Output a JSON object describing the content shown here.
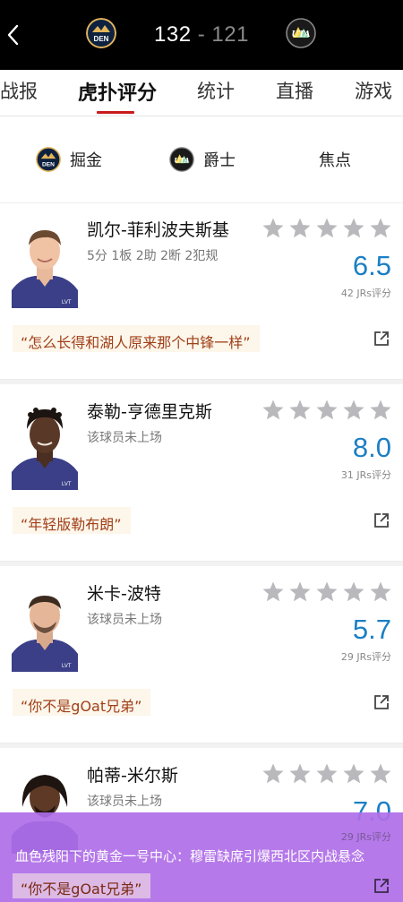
{
  "score": {
    "home": "132",
    "separator": "-",
    "away": "121",
    "home_team": "DEN",
    "away_team": "UTA"
  },
  "tabs": [
    {
      "label": "战报"
    },
    {
      "label": "虎扑评分"
    },
    {
      "label": "统计"
    },
    {
      "label": "直播"
    },
    {
      "label": "游戏"
    }
  ],
  "active_tab": "虎扑评分",
  "filters": [
    {
      "label": "掘金",
      "logo": "DEN"
    },
    {
      "label": "爵士",
      "logo": "UTA"
    },
    {
      "label": "焦点"
    }
  ],
  "players": [
    {
      "name": "凯尔-菲利波夫斯基",
      "stat": "5分 1板 2助 2断 2犯规",
      "rating": "6.5",
      "count": "42 JRs评分",
      "comment": "“怎么长得和湖人原来那个中锋一样”",
      "stars": 5
    },
    {
      "name": "泰勒-亨德里克斯",
      "stat": "该球员未上场",
      "rating": "8.0",
      "count": "31 JRs评分",
      "comment": "“年轻版勒布朗”",
      "stars": 5
    },
    {
      "name": "米卡-波特",
      "stat": "该球员未上场",
      "rating": "5.7",
      "count": "29 JRs评分",
      "comment": "“你不是gOat兄弟”",
      "stars": 5
    },
    {
      "name": "帕蒂-米尔斯",
      "stat": "该球员未上场",
      "rating": "7.0",
      "count": "29 JRs评分",
      "comment": "“你不是gOat兄弟”",
      "stars": 5
    }
  ],
  "banner": {
    "text": "血色残阳下的黄金一号中心：穆雷缺席引爆西北区内战悬念"
  },
  "colors": {
    "accent": "#c91b1b",
    "rating": "#1b7fc4",
    "comment_text": "#a0401a",
    "star": "#b9b9bd",
    "banner": "#af6ee8"
  }
}
